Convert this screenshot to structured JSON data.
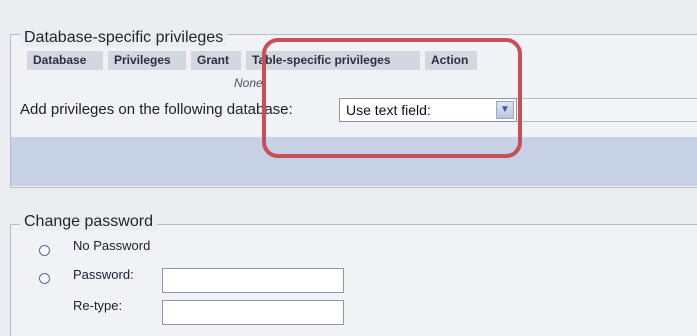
{
  "db_privileges": {
    "legend": "Database-specific privileges",
    "columns": [
      "Database",
      "Privileges",
      "Grant",
      "Table-specific privileges",
      "Action"
    ],
    "empty_text": "None",
    "add_label": "Add privileges on the following database:",
    "select_value": "Use text field:"
  },
  "change_password": {
    "legend": "Change password",
    "no_password_label": "No Password",
    "password_label": "Password:",
    "retype_label": "Re-type:"
  },
  "colors": {
    "highlight": "#c65058",
    "header_bg": "#d3d7e0",
    "band": "#c7d1e5"
  }
}
